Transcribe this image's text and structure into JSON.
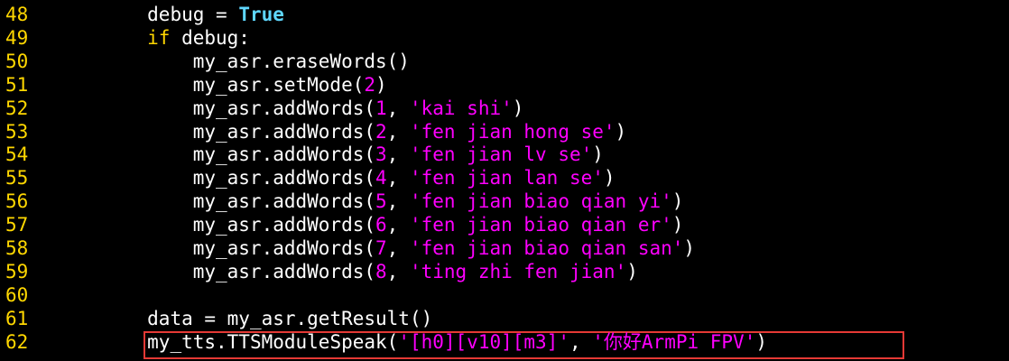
{
  "editor": {
    "lines": [
      {
        "num": "48",
        "indent": "        ",
        "parts": [
          {
            "t": "debug = ",
            "c": "plain"
          },
          {
            "t": "True",
            "c": "kw-true"
          }
        ]
      },
      {
        "num": "49",
        "indent": "        ",
        "parts": [
          {
            "t": "if",
            "c": "kw-if"
          },
          {
            "t": " debug:",
            "c": "plain"
          }
        ]
      },
      {
        "num": "50",
        "indent": "            ",
        "parts": [
          {
            "t": "my_asr.eraseWords()",
            "c": "plain"
          }
        ]
      },
      {
        "num": "51",
        "indent": "            ",
        "parts": [
          {
            "t": "my_asr.setMode(",
            "c": "plain"
          },
          {
            "t": "2",
            "c": "num"
          },
          {
            "t": ")",
            "c": "plain"
          }
        ]
      },
      {
        "num": "52",
        "indent": "            ",
        "parts": [
          {
            "t": "my_asr.addWords(",
            "c": "plain"
          },
          {
            "t": "1",
            "c": "num"
          },
          {
            "t": ", ",
            "c": "plain"
          },
          {
            "t": "'kai shi'",
            "c": "str"
          },
          {
            "t": ")",
            "c": "plain"
          }
        ]
      },
      {
        "num": "53",
        "indent": "            ",
        "parts": [
          {
            "t": "my_asr.addWords(",
            "c": "plain"
          },
          {
            "t": "2",
            "c": "num"
          },
          {
            "t": ", ",
            "c": "plain"
          },
          {
            "t": "'fen jian hong se'",
            "c": "str"
          },
          {
            "t": ")",
            "c": "plain"
          }
        ]
      },
      {
        "num": "54",
        "indent": "            ",
        "parts": [
          {
            "t": "my_asr.addWords(",
            "c": "plain"
          },
          {
            "t": "3",
            "c": "num"
          },
          {
            "t": ", ",
            "c": "plain"
          },
          {
            "t": "'fen jian lv se'",
            "c": "str"
          },
          {
            "t": ")",
            "c": "plain"
          }
        ]
      },
      {
        "num": "55",
        "indent": "            ",
        "parts": [
          {
            "t": "my_asr.addWords(",
            "c": "plain"
          },
          {
            "t": "4",
            "c": "num"
          },
          {
            "t": ", ",
            "c": "plain"
          },
          {
            "t": "'fen jian lan se'",
            "c": "str"
          },
          {
            "t": ")",
            "c": "plain"
          }
        ]
      },
      {
        "num": "56",
        "indent": "            ",
        "parts": [
          {
            "t": "my_asr.addWords(",
            "c": "plain"
          },
          {
            "t": "5",
            "c": "num"
          },
          {
            "t": ", ",
            "c": "plain"
          },
          {
            "t": "'fen jian biao qian yi'",
            "c": "str"
          },
          {
            "t": ")",
            "c": "plain"
          }
        ]
      },
      {
        "num": "57",
        "indent": "            ",
        "parts": [
          {
            "t": "my_asr.addWords(",
            "c": "plain"
          },
          {
            "t": "6",
            "c": "num"
          },
          {
            "t": ", ",
            "c": "plain"
          },
          {
            "t": "'fen jian biao qian er'",
            "c": "str"
          },
          {
            "t": ")",
            "c": "plain"
          }
        ]
      },
      {
        "num": "58",
        "indent": "            ",
        "parts": [
          {
            "t": "my_asr.addWords(",
            "c": "plain"
          },
          {
            "t": "7",
            "c": "num"
          },
          {
            "t": ", ",
            "c": "plain"
          },
          {
            "t": "'fen jian biao qian san'",
            "c": "str"
          },
          {
            "t": ")",
            "c": "plain"
          }
        ]
      },
      {
        "num": "59",
        "indent": "            ",
        "parts": [
          {
            "t": "my_asr.addWords(",
            "c": "plain"
          },
          {
            "t": "8",
            "c": "num"
          },
          {
            "t": ", ",
            "c": "plain"
          },
          {
            "t": "'ting zhi fen jian'",
            "c": "str"
          },
          {
            "t": ")",
            "c": "plain"
          }
        ]
      },
      {
        "num": "60",
        "indent": "",
        "parts": []
      },
      {
        "num": "61",
        "indent": "        ",
        "parts": [
          {
            "t": "data = my_asr.getResult()",
            "c": "plain"
          }
        ]
      },
      {
        "num": "62",
        "indent": "        ",
        "parts": [
          {
            "t": "my_tts.TTSModuleSpeak(",
            "c": "plain"
          },
          {
            "t": "'[h0][v10][m3]'",
            "c": "str"
          },
          {
            "t": ", ",
            "c": "plain"
          },
          {
            "t": "'你好ArmPi FPV'",
            "c": "str"
          },
          {
            "t": ")",
            "c": "plain"
          }
        ]
      }
    ],
    "highlighted_line": "62"
  },
  "colors": {
    "background": "#000000",
    "line_number": "#ffd700",
    "keyword_true": "#5fd7ff",
    "keyword_if": "#ffd700",
    "string": "#ff00ff",
    "plain": "#ffffff",
    "highlight_border": "#e53935"
  }
}
